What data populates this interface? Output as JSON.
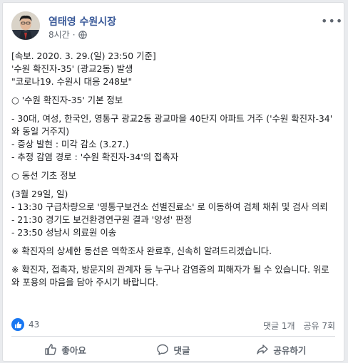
{
  "post": {
    "author": "염태영 수원시장",
    "time": "8시간",
    "icons": {
      "privacy": "globe-icon",
      "menu": "more-icon"
    },
    "paragraphs": [
      "[속보. 2020. 3. 29.(일) 23:50 기준]",
      "'수원 확진자-35' (광교2동) 발생",
      "\"코로나19. 수원시 대응 248보\"",
      "",
      "○ '수원 확진자-35' 기본 정보",
      "",
      "- 30대, 여성, 한국인, 영통구 광교2동 광교마을 40단지 아파트 거주 ('수원 확진자-34' 와 동일 거주지)",
      "- 증상 발현 : 미각 감소 (3.27.)",
      "- 추정 감염 경로 : '수원 확진자-34'의 접촉자",
      "",
      "○ 동선 기초 정보",
      "",
      "(3월 29일, 일)",
      "- 13:30 구급차량으로 '영통구보건소 선별진료소' 로 이동하여 검체 채취 및 검사 의뢰",
      "- 21:30 경기도 보건환경연구원 결과 '양성' 판정",
      "- 23:50 성남시 의료원 이송",
      "",
      "※ 확진자의 상세한 동선은 역학조사 완료후, 신속히 알려드리겠습니다.",
      "",
      "※ 확진자, 접촉자, 방문지의 관계자 등 누구나 감염증의 피해자가 될 수 있습니다. 위로와 포용의 마음을 담아 주시기 바랍니다."
    ]
  },
  "reactions": {
    "count": "43",
    "comments": "댓글 1개",
    "shares": "공유 7회",
    "icon": "thumbs-up-icon"
  },
  "actions": {
    "like": {
      "label": "좋아요",
      "icon": "like-icon"
    },
    "comment": {
      "label": "댓글",
      "icon": "comment-icon"
    },
    "share": {
      "label": "공유하기",
      "icon": "share-icon"
    }
  },
  "colors": {
    "author": "#385898",
    "meta": "#606770",
    "like_badge": "#1877f2",
    "text": "#1c1e21"
  }
}
